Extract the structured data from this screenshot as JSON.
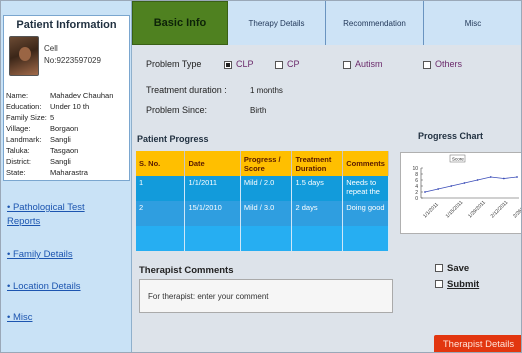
{
  "patient": {
    "title": "Patient Information",
    "cell_label": "Cell",
    "cell_no": "No:9223597029",
    "fields": [
      {
        "key": "Name:",
        "value": "Mahadev Chauhan"
      },
      {
        "key": "Education:",
        "value": "Under 10 th"
      },
      {
        "key": "Family Size:",
        "value": "5"
      },
      {
        "key": "Village:",
        "value": "Borgaon"
      },
      {
        "key": "Landmark:",
        "value": "Sangli"
      },
      {
        "key": "Taluka:",
        "value": "Tasgaon"
      },
      {
        "key": "District:",
        "value": "Sangli"
      },
      {
        "key": "State:",
        "value": "Maharastra"
      }
    ]
  },
  "sidebar_links": [
    {
      "label": "• Pathological Test",
      "label2": "Reports"
    },
    {
      "label": "• Family Details"
    },
    {
      "label": "• Location Details"
    },
    {
      "label": "• Misc"
    }
  ],
  "tabs": [
    "Basic Info",
    "Therapy Details",
    "Recommendation",
    "Misc"
  ],
  "basic": {
    "problem_type_label": "Problem Type",
    "options": [
      "CLP",
      "CP",
      "Autism",
      "Others"
    ],
    "treatment_label": "Treatment duration :",
    "treatment_value": "1 months",
    "since_label": "Problem Since:",
    "since_value": "Birth"
  },
  "progress": {
    "title": "Patient Progress",
    "headers": [
      "S. No.",
      "Date",
      "Progress / Score",
      "Treatment Duration",
      "Comments"
    ],
    "rows": [
      [
        "1",
        "1/1/2011",
        "Mild / 2.0",
        "1.5 days",
        "Needs to repeat the"
      ],
      [
        "2",
        "15/1/2010",
        "Mild / 3.0",
        "2 days",
        "Doing good"
      ],
      [
        "",
        "",
        "",
        "",
        ""
      ]
    ]
  },
  "chart_data": {
    "type": "line",
    "title": "Progress Chart",
    "legend": "Score",
    "x": [
      "1/1/2011",
      "1/15/2011",
      "1/29/2011",
      "2/12/2011",
      "2/26/2011"
    ],
    "values": [
      2.0,
      3.0,
      4.0,
      5.0,
      6.0,
      7.0,
      6.5,
      7.0
    ],
    "ylim": [
      0,
      10
    ],
    "yticks": [
      "0",
      "2",
      "4",
      "6",
      "8",
      "10"
    ],
    "line_color": "#3a4cb8"
  },
  "comments": {
    "title": "Therapist Comments",
    "placeholder": "For therapist: enter your comment"
  },
  "actions": {
    "save": "Save",
    "submit": "Submit",
    "bottom_button": "Therapist Details"
  }
}
